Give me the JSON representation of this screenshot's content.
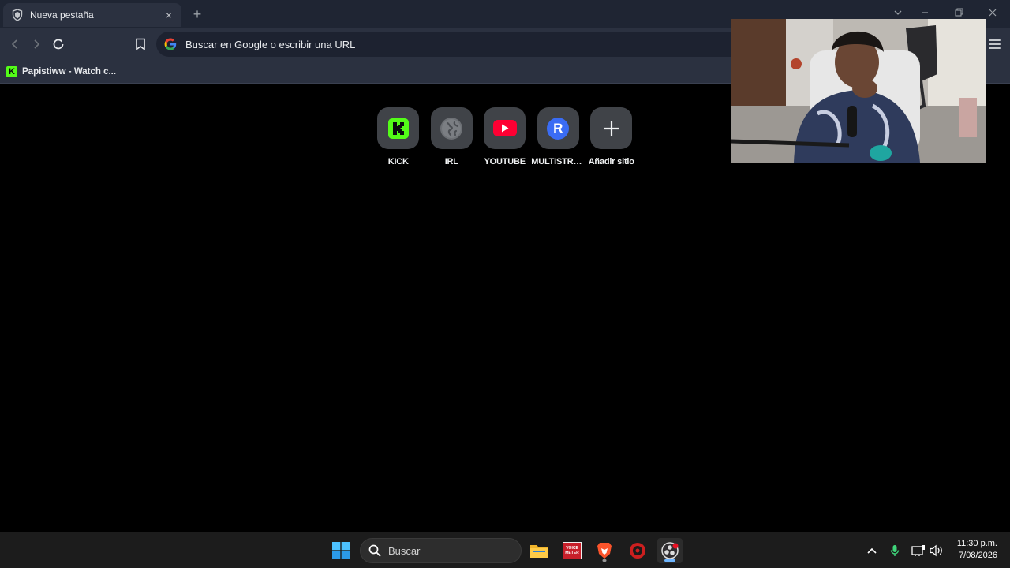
{
  "browser": {
    "tab": {
      "title": "Nueva pestaña",
      "favicon": "shield-icon",
      "close": "×"
    },
    "new_tab": "+",
    "window_controls": [
      "chevron-down-icon",
      "minimize-icon",
      "restore-icon",
      "close-icon"
    ]
  },
  "toolbar": {
    "back": "‹",
    "forward": "›",
    "omnibox_placeholder": "Buscar en Google o escribir una URL"
  },
  "bookmarks": [
    {
      "label": "Papistiww - Watch c...",
      "icon": "kick-icon",
      "icon_letter": "K"
    }
  ],
  "shortcuts": [
    {
      "label": "KICK",
      "icon": "kick-icon",
      "letter": "K",
      "bg": "#53fc18",
      "fg": "#0b0e0f"
    },
    {
      "label": "IRL",
      "icon": "globe-icon"
    },
    {
      "label": "YOUTUBE",
      "icon": "youtube-icon",
      "bg": "#ff0033"
    },
    {
      "label": "MULTISTRE...",
      "icon": "restream-icon",
      "letter": "R",
      "bg": "#3a6cf4"
    },
    {
      "label": "Añadir sitio",
      "icon": "plus-icon"
    }
  ],
  "taskbar": {
    "search_placeholder": "Buscar",
    "voicemeeter_text": "VOICE METER",
    "clock_time": "11:30 p.m.",
    "clock_date": "7/08/2026"
  },
  "colors": {
    "tabstrip": "#1f2533",
    "toolbar": "#2b3140",
    "kick_green": "#53fc18",
    "youtube_red": "#ff0033",
    "restream_blue": "#3a6cf4"
  }
}
